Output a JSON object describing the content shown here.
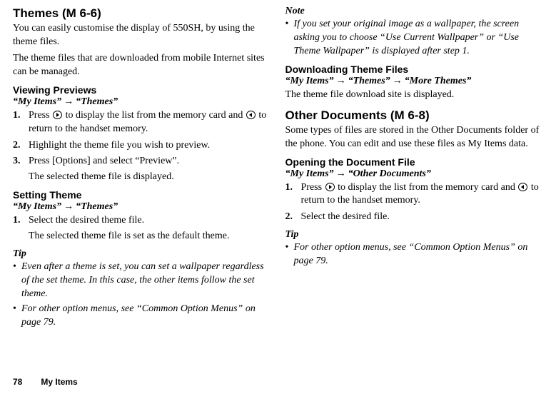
{
  "left": {
    "h1": "Themes",
    "h1_code": " (M 6-6)",
    "intro1": "You can easily customise the display of 550SH, by using the theme files.",
    "intro2": "The theme files that are downloaded from mobile Internet sites can be managed.",
    "sec1_head": "Viewing Previews",
    "sec1_path_a": "“My Items”",
    "sec1_path_b": "“Themes”",
    "sec1_steps": [
      {
        "num": "1.",
        "a": "Press ",
        "b": " to display the list from the memory card and ",
        "c": " to return to the handset memory."
      },
      {
        "num": "2.",
        "text": "Highlight the theme file you wish to preview."
      },
      {
        "num": "3.",
        "a": "Press [Options] and select “Preview”.",
        "sub": "The selected theme file is displayed."
      }
    ],
    "sec2_head": "Setting Theme",
    "sec2_path_a": "“My Items”",
    "sec2_path_b": "“Themes”",
    "sec2_step_num": "1.",
    "sec2_step_a": "Select the desired theme file.",
    "sec2_step_sub": "The selected theme file is set as the default theme.",
    "tip_head": "Tip",
    "tip_items": [
      "Even after a theme is set, you can set a wallpaper regardless of the set theme. In this case, the other items follow the set theme.",
      "For other option menus, see “Common Option Menus” on page 79."
    ]
  },
  "right": {
    "note_head": "Note",
    "note_items": [
      "If you set your original image as a wallpaper, the screen asking you to choose “Use Current Wallpaper” or “Use Theme Wallpaper” is displayed after step 1."
    ],
    "sec3_head": "Downloading Theme Files",
    "sec3_path_a": "“My Items”",
    "sec3_path_b": "“Themes”",
    "sec3_path_c": "“More Themes”",
    "sec3_body": "The theme file download site is displayed.",
    "h2": "Other Documents",
    "h2_code": " (M 6-8)",
    "h2_body": "Some types of files are stored in the Other Documents folder of the phone. You can edit and use these files as My Items data.",
    "sec4_head": "Opening the Document File",
    "sec4_path_a": "“My Items”",
    "sec4_path_b": "“Other Documents”",
    "sec4_step1_num": "1.",
    "sec4_step1_a": "Press ",
    "sec4_step1_b": " to display the list from the memory card and ",
    "sec4_step1_c": " to return to the handset memory.",
    "sec4_step2_num": "2.",
    "sec4_step2_text": "Select the desired file.",
    "tip2_head": "Tip",
    "tip2_items": [
      "For other option menus, see “Common Option Menus” on page 79."
    ]
  },
  "footer": {
    "page": "78",
    "section": "My Items"
  },
  "glyphs": {
    "arrow": "→",
    "bullet": "•"
  }
}
